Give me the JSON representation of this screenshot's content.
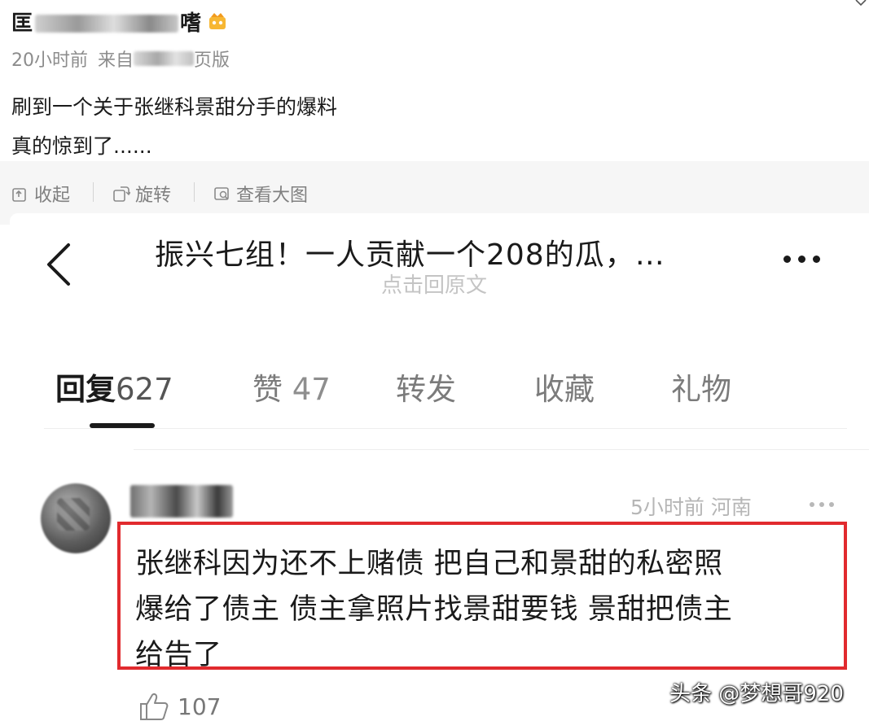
{
  "post": {
    "author_visible_start": "匡",
    "author_visible_end": "嗜",
    "vip_icon": "vip-crown-icon",
    "time": "20小时前",
    "source_prefix": "来自",
    "source_suffix": "页版",
    "text_line1": "刷到一个关于张继科景甜分手的爆料",
    "text_line2": "真的惊到了......"
  },
  "image_toolbar": {
    "collapse": "收起",
    "rotate": "旋转",
    "view_large": "查看大图"
  },
  "screenshot": {
    "title": "振兴七组！一人贡献一个208的瓜，…",
    "subtitle": "点击回原文",
    "tabs": [
      {
        "label": "回复",
        "count": "627"
      },
      {
        "label": "赞",
        "count": "47"
      },
      {
        "label": "转发",
        "count": ""
      },
      {
        "label": "收藏",
        "count": ""
      },
      {
        "label": "礼物",
        "count": ""
      }
    ],
    "comment": {
      "time": "5小时前",
      "location": "河南",
      "line1": "张继科因为还不上赌债 把自己和景甜的私密照",
      "line2": "爆给了债主 债主拿照片找景甜要钱 景甜把债主",
      "line3": "给告了",
      "likes": "107"
    }
  },
  "watermark": "头条 @梦想哥920",
  "colors": {
    "highlight_border": "#e12a2e",
    "meta_gray": "#8c8c8c",
    "toolbar_bg": "#f6f6f6"
  }
}
